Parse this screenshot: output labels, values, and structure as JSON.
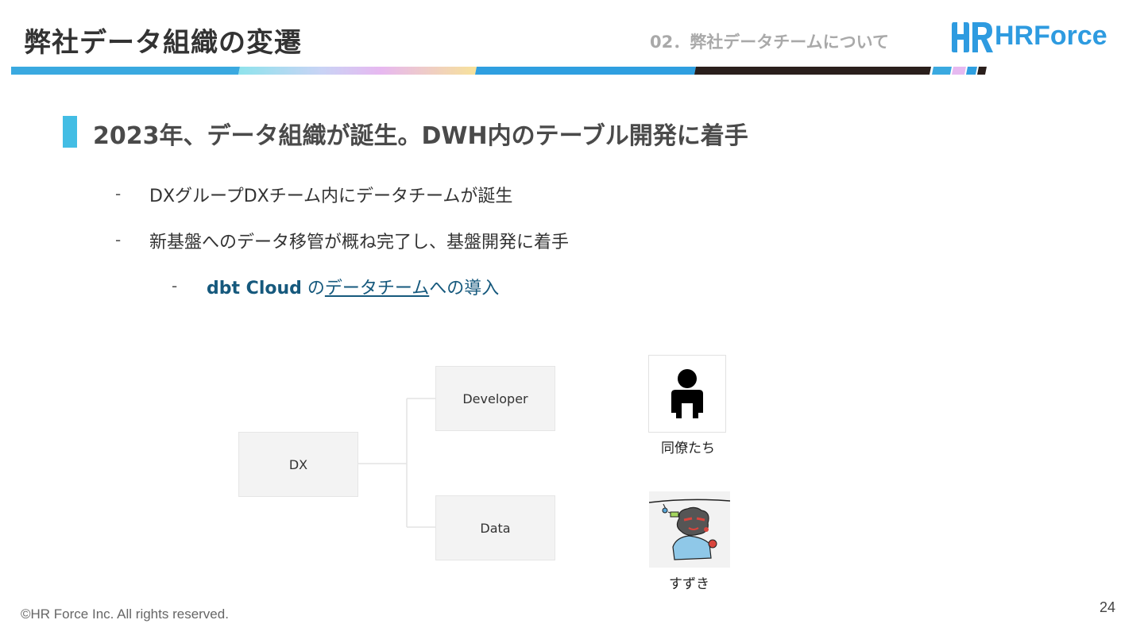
{
  "header": {
    "title": "弊社データ組織の変遷",
    "section_label": "02．弊社データチームについて",
    "logo_text": "HRForce",
    "logo_mark_text": "HR",
    "brand_color": "#2e9be0"
  },
  "heading": {
    "text": "2023年、データ組織が誕生。DWH内のテーブル開発に着手",
    "accent_color": "#43bde4"
  },
  "bullets": [
    {
      "dash": "-",
      "text": "DXグループDXチーム内にデータチームが誕生"
    },
    {
      "dash": "-",
      "text": "新基盤へのデータ移管が概ね完了し、基盤開発に着手"
    }
  ],
  "sub_bullet": {
    "dash": "-",
    "strong": "dbt Cloud",
    "pre": " の",
    "link": "データチーム",
    "post": "への導入",
    "color": "#16597d"
  },
  "diagram": {
    "root": "DX",
    "children": [
      "Developer",
      "Data"
    ]
  },
  "people": {
    "colleagues_label": "同僚たち",
    "member_label": "すずき"
  },
  "footer": {
    "copyright": "©HR Force Inc. All rights reserved.",
    "page_number": "24"
  }
}
